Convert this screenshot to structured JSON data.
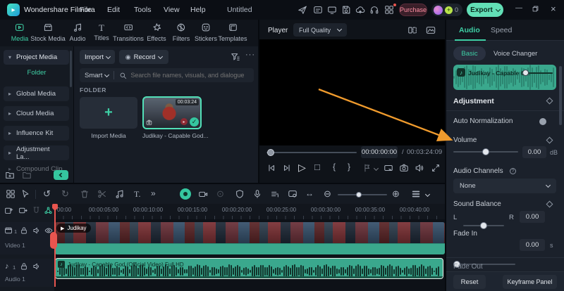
{
  "titlebar": {
    "app_name": "Wondershare Filmora",
    "menus": [
      "File",
      "Edit",
      "Tools",
      "View",
      "Help"
    ],
    "document_title": "Untitled",
    "purchase_label": "Purchase",
    "coin_count": "0",
    "export_label": "Export"
  },
  "ribbon": {
    "tabs": [
      {
        "label": "Media"
      },
      {
        "label": "Stock Media"
      },
      {
        "label": "Audio"
      },
      {
        "label": "Titles"
      },
      {
        "label": "Transitions"
      },
      {
        "label": "Effects"
      },
      {
        "label": "Filters"
      },
      {
        "label": "Stickers"
      },
      {
        "label": "Templates"
      }
    ]
  },
  "sidebar": {
    "items": [
      {
        "label": "Project Media"
      },
      {
        "label": "Folder"
      },
      {
        "label": "Global Media"
      },
      {
        "label": "Cloud Media"
      },
      {
        "label": "Influence Kit"
      },
      {
        "label": "Adjustment La..."
      },
      {
        "label": "Compound Clip"
      }
    ]
  },
  "media_panel": {
    "import_label": "Import",
    "record_label": "Record",
    "search_mode": "Smart",
    "search_placeholder": "Search file names, visuals, and dialogue",
    "folder_label": "FOLDER",
    "items": [
      {
        "label": "Import Media"
      },
      {
        "label": "Judikay - Capable God...",
        "duration": "00:03:24"
      }
    ]
  },
  "player": {
    "title": "Player",
    "quality": "Full Quality",
    "current_time": "00:00:00:00",
    "separator": "/",
    "total_time": "00:03:24:09"
  },
  "right_panel": {
    "tabs": [
      {
        "label": "Audio"
      },
      {
        "label": "Speed"
      }
    ],
    "subtabs": [
      {
        "label": "Basic"
      },
      {
        "label": "Voice Changer"
      }
    ],
    "clip_name": "Judikay - Capable G...",
    "adjustment_label": "Adjustment",
    "auto_normalization_label": "Auto Normalization",
    "volume": {
      "label": "Volume",
      "value": "0.00",
      "unit": "dB"
    },
    "audio_channels": {
      "label": "Audio Channels",
      "value": "None"
    },
    "sound_balance": {
      "label": "Sound Balance",
      "left": "L",
      "right": "R",
      "value": "0.00"
    },
    "fade_in": {
      "label": "Fade In",
      "value": "0.00",
      "unit": "s"
    },
    "fade_out_label": "Fade Out",
    "reset_label": "Reset",
    "keyframe_label": "Keyframe Panel"
  },
  "timeline": {
    "ruler": [
      "00:00",
      "00:00:05:00",
      "00:00:10:00",
      "00:00:15:00",
      "00:00:20:00",
      "00:00:25:00",
      "00:00:30:00",
      "00:00:35:00",
      "00:00:40:00"
    ],
    "tracks": [
      {
        "name": "Video 1",
        "count": "1",
        "clip_label": "Judikay"
      },
      {
        "name": "Audio 1",
        "count": "1",
        "clip_label": "Judikay - Capable God (Official Video) Full HD"
      }
    ]
  },
  "colors": {
    "accent_teal": "#3ecfa5",
    "export_green": "#62dfb6",
    "purchase_pink": "#ff8fa3",
    "clip_teal": "#3aa88d",
    "arrow_orange": "#f09b2d",
    "playhead_red": "#e8554f"
  },
  "icons": {
    "note": "♪",
    "play": "▷",
    "stop": "□",
    "brace_l": "{",
    "brace_r": "}",
    "undo": "↺",
    "redo": "↻",
    "more": "···",
    "double_right": "»",
    "text_tool": "T.",
    "zoom_in": "⊕",
    "zoom_out": "⊖",
    "fit": "↔",
    "plus": "+",
    "check": "✓",
    "record_dot": "◉",
    "dim_record": "⊙",
    "caret_down": "▾",
    "caret_right": "▸",
    "minimize": "—",
    "close": "×",
    "media_play": "▶",
    "info": "?"
  }
}
